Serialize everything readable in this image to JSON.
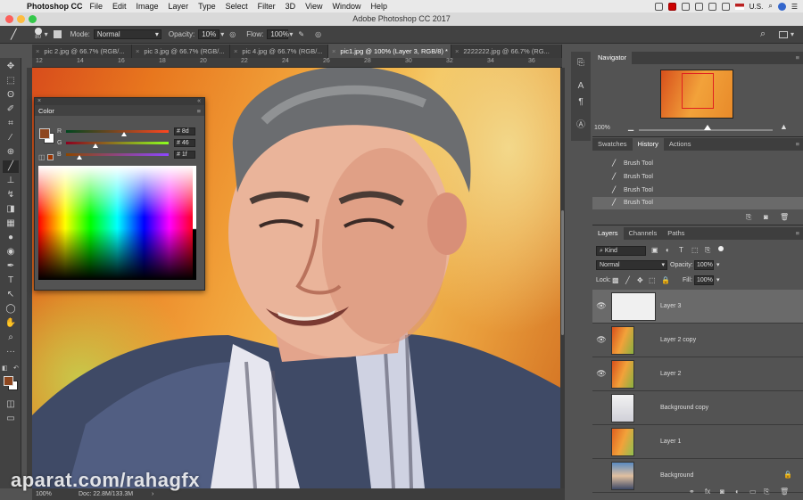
{
  "menubar": {
    "app": "Photoshop CC",
    "items": [
      "File",
      "Edit",
      "Image",
      "Layer",
      "Type",
      "Select",
      "Filter",
      "3D",
      "View",
      "Window",
      "Help"
    ],
    "locale": "U.S."
  },
  "window_title": "Adobe Photoshop CC 2017",
  "options": {
    "brush_size": "80",
    "mode_label": "Mode:",
    "mode_value": "Normal",
    "opacity_label": "Opacity:",
    "opacity_value": "10%",
    "flow_label": "Flow:",
    "flow_value": "100%"
  },
  "doc_tabs": [
    {
      "label": "pic 2.jpg @ 66.7% (RGB/...",
      "active": false
    },
    {
      "label": "pic 3.jpg @ 66.7% (RGB/...",
      "active": false
    },
    {
      "label": "pic 4.jpg @ 66.7% (RGB/...",
      "active": false
    },
    {
      "label": "pic1.jpg @ 100% (Layer 3, RGB/8) *",
      "active": true
    },
    {
      "label": "2222222.jpg @ 66.7% (RG...",
      "active": false
    }
  ],
  "ruler_ticks": [
    "12",
    "14",
    "16",
    "18",
    "20",
    "22",
    "24",
    "26",
    "28",
    "30",
    "32",
    "34",
    "36"
  ],
  "color_panel": {
    "title": "Color",
    "r_label": "R",
    "g_label": "G",
    "b_label": "B",
    "r_value": "8d",
    "g_value": "46",
    "b_value": "1f",
    "fg_color": "#8d461f"
  },
  "status": {
    "zoom": "100%",
    "doc": "Doc: 22.8M/133.3M"
  },
  "navigator": {
    "title": "Navigator",
    "zoom": "100%"
  },
  "history_tabs": [
    "Swatches",
    "History",
    "Actions"
  ],
  "history_items": [
    "Brush Tool",
    "Brush Tool",
    "Brush Tool",
    "Brush Tool"
  ],
  "layers_tabs": [
    "Layers",
    "Channels",
    "Paths"
  ],
  "layers_controls": {
    "kind": "Kind",
    "blend": "Normal",
    "opacity_label": "Opacity:",
    "opacity": "100%",
    "lock_label": "Lock:",
    "fill_label": "Fill:",
    "fill": "100%"
  },
  "layers": [
    {
      "name": "Layer 3",
      "visible": true,
      "selected": true
    },
    {
      "name": "Layer 2 copy",
      "visible": true,
      "selected": false
    },
    {
      "name": "Layer 2",
      "visible": true,
      "selected": false
    },
    {
      "name": "Background copy",
      "visible": false,
      "selected": false
    },
    {
      "name": "Layer 1",
      "visible": false,
      "selected": false
    },
    {
      "name": "Background",
      "visible": false,
      "selected": false
    }
  ],
  "watermark": "aparat.com/rahagfx"
}
